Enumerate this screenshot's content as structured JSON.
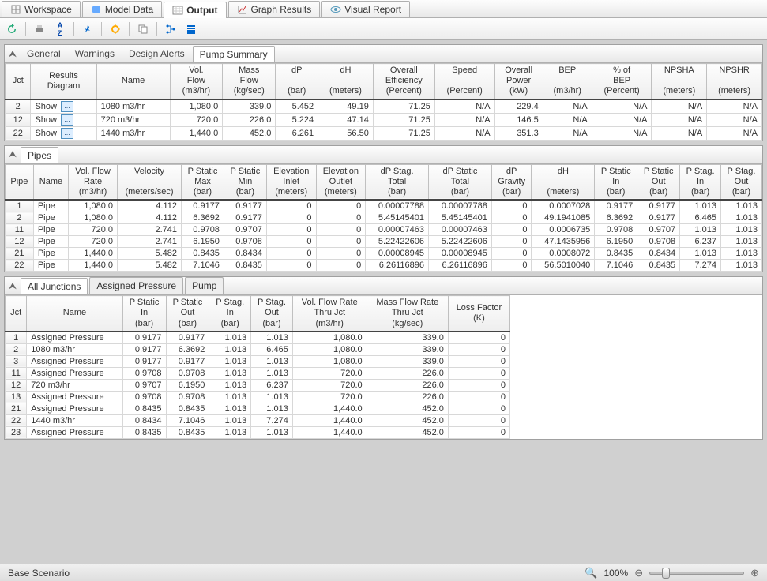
{
  "app": {
    "main_tabs": [
      {
        "label": "Workspace",
        "icon": "workspace"
      },
      {
        "label": "Model Data",
        "icon": "modeldata"
      },
      {
        "label": "Output",
        "icon": "output",
        "active": true
      },
      {
        "label": "Graph Results",
        "icon": "graph"
      },
      {
        "label": "Visual Report",
        "icon": "visual"
      }
    ]
  },
  "toolbar": {
    "buttons": [
      "refresh",
      "print",
      "sort-az",
      "pin",
      "highlight",
      "copy",
      "tree",
      "list"
    ]
  },
  "section1": {
    "tabs": [
      "General",
      "Warnings",
      "Design Alerts",
      "Pump Summary"
    ],
    "active": "Pump Summary",
    "columns": [
      "Jct",
      "Results\nDiagram",
      "Name",
      "Vol.\nFlow\n(m3/hr)",
      "Mass\nFlow\n(kg/sec)",
      "dP\n\n(bar)",
      "dH\n\n(meters)",
      "Overall\nEfficiency\n(Percent)",
      "Speed\n\n(Percent)",
      "Overall\nPower\n(kW)",
      "BEP\n\n(m3/hr)",
      "% of\nBEP\n(Percent)",
      "NPSHA\n\n(meters)",
      "NPSHR\n\n(meters)"
    ],
    "rows": [
      {
        "jct": "2",
        "diag": "Show",
        "name": "1080 m3/hr",
        "vf": "1,080.0",
        "mf": "339.0",
        "dp": "5.452",
        "dh": "49.19",
        "eff": "71.25",
        "spd": "N/A",
        "pow": "229.4",
        "bep": "N/A",
        "pbep": "N/A",
        "npa": "N/A",
        "npr": "N/A"
      },
      {
        "jct": "12",
        "diag": "Show",
        "name": "720 m3/hr",
        "vf": "720.0",
        "mf": "226.0",
        "dp": "5.224",
        "dh": "47.14",
        "eff": "71.25",
        "spd": "N/A",
        "pow": "146.5",
        "bep": "N/A",
        "pbep": "N/A",
        "npa": "N/A",
        "npr": "N/A"
      },
      {
        "jct": "22",
        "diag": "Show",
        "name": "1440 m3/hr",
        "vf": "1,440.0",
        "mf": "452.0",
        "dp": "6.261",
        "dh": "56.50",
        "eff": "71.25",
        "spd": "N/A",
        "pow": "351.3",
        "bep": "N/A",
        "pbep": "N/A",
        "npa": "N/A",
        "npr": "N/A"
      }
    ]
  },
  "section2": {
    "tabs": [
      "Pipes"
    ],
    "active": "Pipes",
    "columns": [
      "Pipe",
      "Name",
      "Vol. Flow\nRate\n(m3/hr)",
      "Velocity\n\n(meters/sec)",
      "P Static\nMax\n(bar)",
      "P Static\nMin\n(bar)",
      "Elevation\nInlet\n(meters)",
      "Elevation\nOutlet\n(meters)",
      "dP Stag.\nTotal\n(bar)",
      "dP Static\nTotal\n(bar)",
      "dP\nGravity\n(bar)",
      "dH\n\n(meters)",
      "P Static\nIn\n(bar)",
      "P Static\nOut\n(bar)",
      "P Stag.\nIn\n(bar)",
      "P Stag.\nOut\n(bar)"
    ],
    "rows": [
      {
        "p": "1",
        "n": "Pipe",
        "vf": "1,080.0",
        "vel": "4.112",
        "pmax": "0.9177",
        "pmin": "0.9177",
        "ei": "0",
        "eo": "0",
        "dps": "0.00007788",
        "dpst": "0.00007788",
        "dpg": "0",
        "dh": "0.0007028",
        "psi": "0.9177",
        "pso": "0.9177",
        "pgi": "1.013",
        "pgo": "1.013"
      },
      {
        "p": "2",
        "n": "Pipe",
        "vf": "1,080.0",
        "vel": "4.112",
        "pmax": "6.3692",
        "pmin": "0.9177",
        "ei": "0",
        "eo": "0",
        "dps": "5.45145401",
        "dpst": "5.45145401",
        "dpg": "0",
        "dh": "49.1941085",
        "psi": "6.3692",
        "pso": "0.9177",
        "pgi": "6.465",
        "pgo": "1.013"
      },
      {
        "p": "11",
        "n": "Pipe",
        "vf": "720.0",
        "vel": "2.741",
        "pmax": "0.9708",
        "pmin": "0.9707",
        "ei": "0",
        "eo": "0",
        "dps": "0.00007463",
        "dpst": "0.00007463",
        "dpg": "0",
        "dh": "0.0006735",
        "psi": "0.9708",
        "pso": "0.9707",
        "pgi": "1.013",
        "pgo": "1.013"
      },
      {
        "p": "12",
        "n": "Pipe",
        "vf": "720.0",
        "vel": "2.741",
        "pmax": "6.1950",
        "pmin": "0.9708",
        "ei": "0",
        "eo": "0",
        "dps": "5.22422606",
        "dpst": "5.22422606",
        "dpg": "0",
        "dh": "47.1435956",
        "psi": "6.1950",
        "pso": "0.9708",
        "pgi": "6.237",
        "pgo": "1.013"
      },
      {
        "p": "21",
        "n": "Pipe",
        "vf": "1,440.0",
        "vel": "5.482",
        "pmax": "0.8435",
        "pmin": "0.8434",
        "ei": "0",
        "eo": "0",
        "dps": "0.00008945",
        "dpst": "0.00008945",
        "dpg": "0",
        "dh": "0.0008072",
        "psi": "0.8435",
        "pso": "0.8434",
        "pgi": "1.013",
        "pgo": "1.013"
      },
      {
        "p": "22",
        "n": "Pipe",
        "vf": "1,440.0",
        "vel": "5.482",
        "pmax": "7.1046",
        "pmin": "0.8435",
        "ei": "0",
        "eo": "0",
        "dps": "6.26116896",
        "dpst": "6.26116896",
        "dpg": "0",
        "dh": "56.5010040",
        "psi": "7.1046",
        "pso": "0.8435",
        "pgi": "7.274",
        "pgo": "1.013"
      }
    ]
  },
  "section3": {
    "tabs": [
      "All Junctions",
      "Assigned Pressure",
      "Pump"
    ],
    "active": "All Junctions",
    "columns": [
      "Jct",
      "Name",
      "P Static\nIn\n(bar)",
      "P Static\nOut\n(bar)",
      "P Stag.\nIn\n(bar)",
      "P Stag.\nOut\n(bar)",
      "Vol. Flow Rate\nThru Jct\n(m3/hr)",
      "Mass Flow Rate\nThru Jct\n(kg/sec)",
      "Loss Factor\n(K)"
    ],
    "rows": [
      {
        "j": "1",
        "n": "Assigned Pressure",
        "psi": "0.9177",
        "pso": "0.9177",
        "pgi": "1.013",
        "pgo": "1.013",
        "vf": "1,080.0",
        "mf": "339.0",
        "lf": "0"
      },
      {
        "j": "2",
        "n": "1080 m3/hr",
        "psi": "0.9177",
        "pso": "6.3692",
        "pgi": "1.013",
        "pgo": "6.465",
        "vf": "1,080.0",
        "mf": "339.0",
        "lf": "0"
      },
      {
        "j": "3",
        "n": "Assigned Pressure",
        "psi": "0.9177",
        "pso": "0.9177",
        "pgi": "1.013",
        "pgo": "1.013",
        "vf": "1,080.0",
        "mf": "339.0",
        "lf": "0"
      },
      {
        "j": "11",
        "n": "Assigned Pressure",
        "psi": "0.9708",
        "pso": "0.9708",
        "pgi": "1.013",
        "pgo": "1.013",
        "vf": "720.0",
        "mf": "226.0",
        "lf": "0"
      },
      {
        "j": "12",
        "n": "720 m3/hr",
        "psi": "0.9707",
        "pso": "6.1950",
        "pgi": "1.013",
        "pgo": "6.237",
        "vf": "720.0",
        "mf": "226.0",
        "lf": "0"
      },
      {
        "j": "13",
        "n": "Assigned Pressure",
        "psi": "0.9708",
        "pso": "0.9708",
        "pgi": "1.013",
        "pgo": "1.013",
        "vf": "720.0",
        "mf": "226.0",
        "lf": "0"
      },
      {
        "j": "21",
        "n": "Assigned Pressure",
        "psi": "0.8435",
        "pso": "0.8435",
        "pgi": "1.013",
        "pgo": "1.013",
        "vf": "1,440.0",
        "mf": "452.0",
        "lf": "0"
      },
      {
        "j": "22",
        "n": "1440 m3/hr",
        "psi": "0.8434",
        "pso": "7.1046",
        "pgi": "1.013",
        "pgo": "7.274",
        "vf": "1,440.0",
        "mf": "452.0",
        "lf": "0"
      },
      {
        "j": "23",
        "n": "Assigned Pressure",
        "psi": "0.8435",
        "pso": "0.8435",
        "pgi": "1.013",
        "pgo": "1.013",
        "vf": "1,440.0",
        "mf": "452.0",
        "lf": "0"
      }
    ]
  },
  "status": {
    "scenario": "Base Scenario",
    "zoom": "100%"
  }
}
